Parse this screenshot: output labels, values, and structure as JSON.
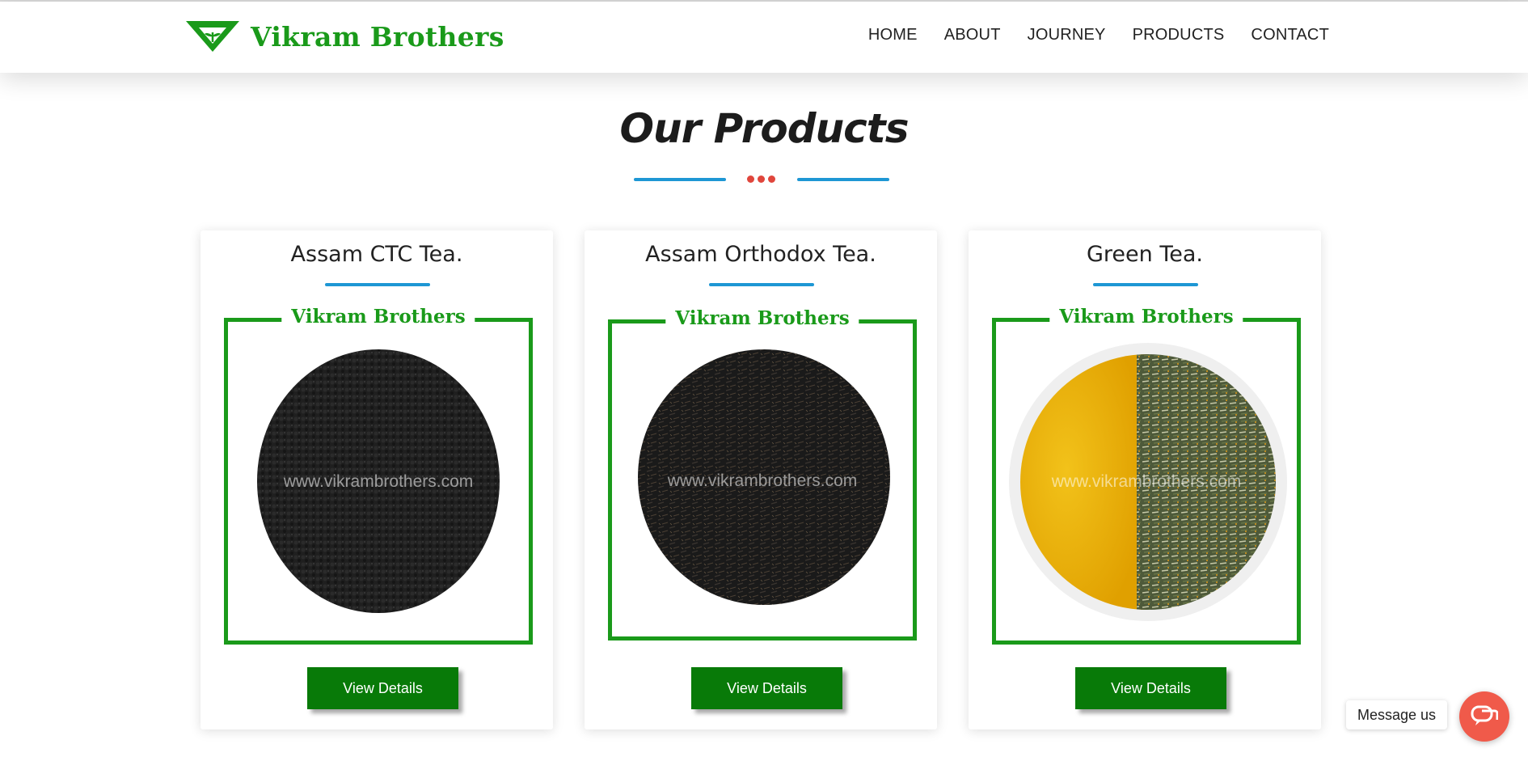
{
  "brand": {
    "name": "Vikram Brothers",
    "logo_icon": "leaf-triangle-logo",
    "color": "#1a9a1a"
  },
  "nav": {
    "items": [
      {
        "label": "HOME"
      },
      {
        "label": "ABOUT"
      },
      {
        "label": "JOURNEY"
      },
      {
        "label": "PRODUCTS"
      },
      {
        "label": "CONTACT"
      }
    ]
  },
  "section": {
    "title": "Our Products",
    "divider_bar_color": "#1e97d4",
    "divider_dot_color": "#e0463c"
  },
  "products": [
    {
      "title": "Assam CTC Tea.",
      "frame_label": "Vikram Brothers",
      "watermark": "www.vikrambrothers.com",
      "image": "black-ctc-tea-granules",
      "button_label": "View Details"
    },
    {
      "title": "Assam Orthodox Tea.",
      "frame_label": "Vikram Brothers",
      "watermark": "www.vikrambrothers.com",
      "image": "black-orthodox-tea-leaves",
      "button_label": "View Details"
    },
    {
      "title": "Green Tea.",
      "frame_label": "Vikram Brothers",
      "watermark": "www.vikrambrothers.com",
      "image": "green-tea-cup-and-leaves",
      "button_label": "View Details"
    }
  ],
  "button_color": "#087a08",
  "chat": {
    "label": "Message us",
    "icon": "chat-bubble-icon",
    "color": "#f05a4a"
  }
}
